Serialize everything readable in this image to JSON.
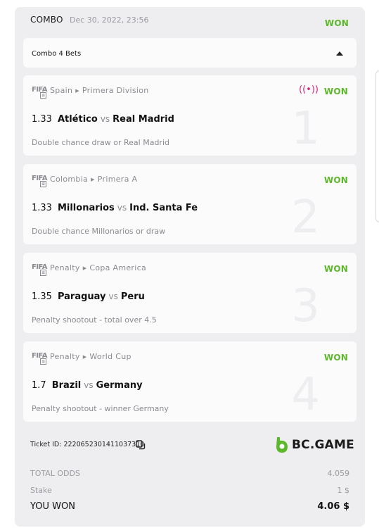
{
  "header": {
    "type_label": "COMBO",
    "date": "Dec 30, 2022, 23:56",
    "status": "WON"
  },
  "combo_bar": {
    "label": "Combo 4 Bets"
  },
  "bets": [
    {
      "game_logo": "FIFA",
      "region": "Spain",
      "league": "Primera Division",
      "live": true,
      "status": "WON",
      "odds": "1.33",
      "team1": "Atlético",
      "vs": "vs",
      "team2": "Real Madrid",
      "selection": "Double chance draw or Real Madrid",
      "index": "1"
    },
    {
      "game_logo": "FIFA",
      "region": "Colombia",
      "league": "Primera A",
      "live": false,
      "status": "WON",
      "odds": "1.33",
      "team1": "Millonarios",
      "vs": "vs",
      "team2": "Ind. Santa Fe",
      "selection": "Double chance Millonarios or draw",
      "index": "2"
    },
    {
      "game_logo": "FIFA",
      "region": "Penalty",
      "league": "Copa America",
      "live": false,
      "status": "WON",
      "odds": "1.35",
      "team1": "Paraguay",
      "vs": "vs",
      "team2": "Peru",
      "selection": "Penalty shootout - total over 4.5",
      "index": "3"
    },
    {
      "game_logo": "FIFA",
      "region": "Penalty",
      "league": "World Cup",
      "live": false,
      "status": "WON",
      "odds": "1.7",
      "team1": "Brazil",
      "vs": "vs",
      "team2": "Germany",
      "selection": "Penalty shootout - winner Germany",
      "index": "4"
    }
  ],
  "ticket": {
    "label": "Ticket ID: 2220652301411037310"
  },
  "brand": {
    "name": "BC.GAME",
    "color": "#5cb82a"
  },
  "summary": {
    "total_odds_label": "TOTAL ODDS",
    "total_odds_value": "4.059",
    "stake_label": "Stake",
    "stake_value": "1 $",
    "won_label": "YOU WON",
    "won_value": "4.06 $"
  },
  "colors": {
    "won_green": "#5cb82a",
    "live_pink": "#d4267a",
    "card_bg": "#eeeef0"
  }
}
